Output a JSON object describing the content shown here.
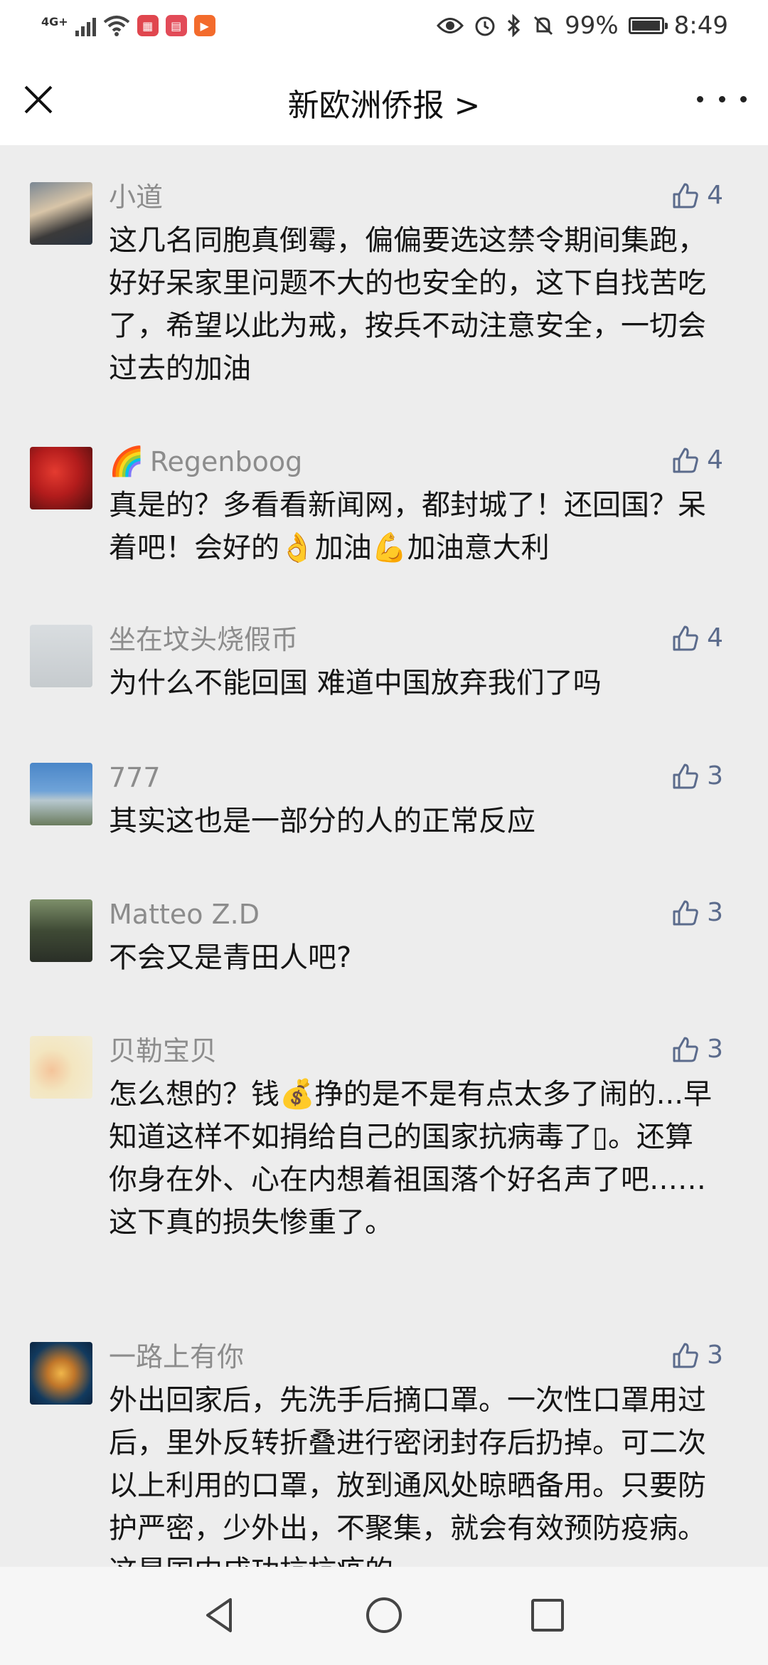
{
  "status_bar": {
    "network": "4G+",
    "battery": "99%",
    "battery_level": 0.99,
    "time": "8:49"
  },
  "header": {
    "title": "新欧洲侨报 >"
  },
  "comments": [
    {
      "name": "小道",
      "name_prefix": "",
      "likes": "4",
      "text": "这几名同胞真倒霉，偏偏要选这禁令期间集跑，好好呆家里问题不大的也安全的，这下自找苦吃了，希望以此为戒，按兵不动注意安全，一切会过去的加油"
    },
    {
      "name": "Regenboog",
      "name_prefix": "🌈",
      "likes": "4",
      "text": "真是的？多看看新闻网，都封城了！还回国？呆着吧！会好的👌加油💪加油意大利"
    },
    {
      "name": "坐在坟头烧假币",
      "name_prefix": "",
      "likes": "4",
      "text": "为什么不能回国 难道中国放弃我们了吗"
    },
    {
      "name": "777",
      "name_prefix": "",
      "likes": "3",
      "text": "其实这也是一部分的人的正常反应"
    },
    {
      "name": "Matteo Z.D",
      "name_prefix": "",
      "likes": "3",
      "text": "不会又是青田人吧?"
    },
    {
      "name": "贝勒宝贝",
      "name_prefix": "",
      "likes": "3",
      "text": "怎么想的？钱💰挣的是不是有点太多了闹的...早知道这样不如捐给自己的国家抗病毒了▯。还算你身在外、心在内想着祖国落个好名声了吧……\n这下真的损失惨重了。"
    },
    {
      "name": "一路上有你",
      "name_prefix": "",
      "likes": "3",
      "text": "外出回家后，先洗手后摘口罩。一次性口罩用过后，里外反转折叠进行密闭封存后扔掉。可二次以上利用的口罩，放到通风处晾晒备用。只要防护严密，少外出，不聚集，就会有效预防疫病。这是国内成功抗抗疫的"
    }
  ],
  "icons": {
    "like": "thumbs-up-icon",
    "close": "close-icon",
    "more": "more-icon"
  },
  "colors": {
    "like": "#5b6b8c",
    "name": "#8c8c8c",
    "background": "#ededed"
  }
}
